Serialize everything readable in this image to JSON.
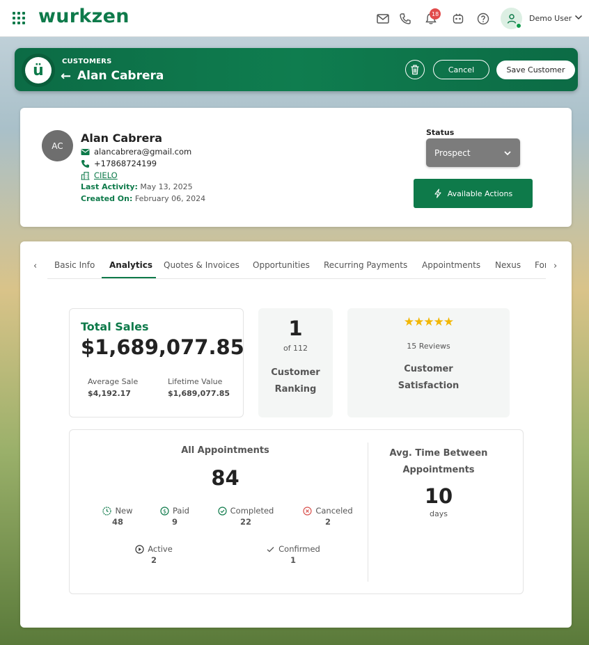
{
  "topbar": {
    "logo": "wurkzen",
    "notification_count": "18",
    "user_name": "Demo User"
  },
  "banner": {
    "breadcrumb": "CUSTOMERS",
    "title": "Alan Cabrera",
    "cancel_label": "Cancel",
    "save_label": "Save Customer"
  },
  "customer": {
    "initials": "AC",
    "name": "Alan Cabrera",
    "email": "alancabrera@gmail.com",
    "phone": "+17868724199",
    "company": "CIELO",
    "last_activity_label": "Last Activity:",
    "last_activity": "May 13, 2025",
    "created_on_label": "Created On:",
    "created_on": "February 06, 2024",
    "status_label": "Status",
    "status_value": "Prospect",
    "actions_label": "Available Actions"
  },
  "tabs": [
    "Basic Info",
    "Analytics",
    "Quotes & Invoices",
    "Opportunities",
    "Recurring Payments",
    "Appointments",
    "Nexus",
    "For"
  ],
  "active_tab": "Analytics",
  "analytics": {
    "total_sales_label": "Total Sales",
    "total_sales": "$1,689,077.85",
    "average_sale_label": "Average Sale",
    "average_sale": "$4,192.17",
    "lifetime_value_label": "Lifetime Value",
    "lifetime_value": "$1,689,077.85",
    "ranking": "1",
    "ranking_of": "of 112",
    "ranking_label_1": "Customer",
    "ranking_label_2": "Ranking",
    "rating_stars": 5,
    "reviews": "15 Reviews",
    "satisfaction_label_1": "Customer",
    "satisfaction_label_2": "Satisfaction"
  },
  "appointments": {
    "title": "All Appointments",
    "total": "84",
    "new_label": "New",
    "new": "48",
    "paid_label": "Paid",
    "paid": "9",
    "completed_label": "Completed",
    "completed": "22",
    "canceled_label": "Canceled",
    "canceled": "2",
    "active_label": "Active",
    "active": "2",
    "confirmed_label": "Confirmed",
    "confirmed": "1",
    "avg_title_1": "Avg. Time Between",
    "avg_title_2": "Appointments",
    "avg_value": "10",
    "avg_unit": "days"
  },
  "colors": {
    "brand": "#0e7a4a",
    "status_bg": "#7c7c7c",
    "badge": "#e14b4b",
    "star": "#f2b705",
    "cancel_icon": "#d9534f"
  }
}
